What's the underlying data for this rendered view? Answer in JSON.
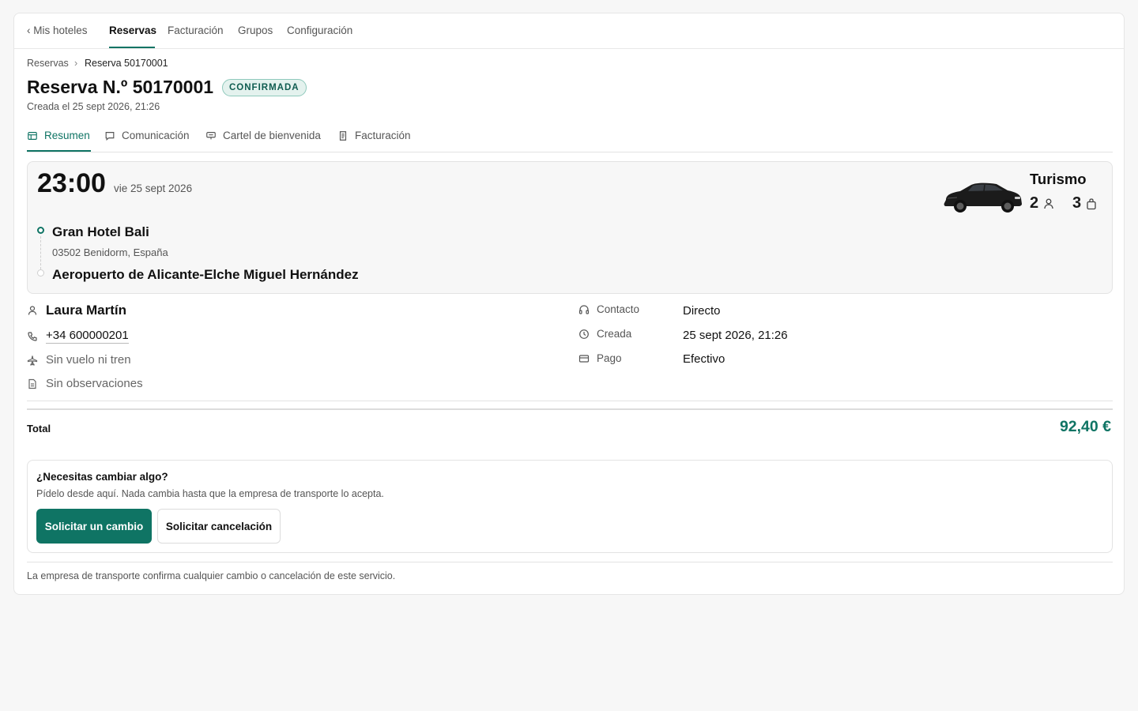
{
  "topnav": {
    "back_label": "‹ Mis hoteles",
    "items": [
      "Reservas",
      "Facturación",
      "Grupos",
      "Configuración"
    ],
    "active": "Reservas"
  },
  "breadcrumb": {
    "parent": "Reservas",
    "separator": "›",
    "current": "Reserva 50170001"
  },
  "booking": {
    "title": "Reserva N.º 50170001",
    "status": "CONFIRMADA",
    "created_line": "Creada el 25 sept 2026, 21:26"
  },
  "subtabs": [
    {
      "label": "Resumen",
      "icon": "summary-icon",
      "active": true
    },
    {
      "label": "Comunicación",
      "icon": "chat-icon",
      "active": false
    },
    {
      "label": "Cartel de bienvenida",
      "icon": "sign-icon",
      "active": false
    },
    {
      "label": "Facturación",
      "icon": "invoice-icon",
      "active": false
    }
  ],
  "trip": {
    "time": "23:00",
    "date": "vie 25 sept 2026",
    "origin_name": "Gran Hotel Bali",
    "origin_address": "03502 Benidorm, España",
    "destination_name": "Aeropuerto de Alicante-Elche Miguel Hernández",
    "vehicle_type": "Turismo",
    "passengers": "2",
    "luggage": "3"
  },
  "guest": {
    "name": "Laura Martín",
    "phone": "+34 600000201",
    "flight": "Sin vuelo ni tren",
    "notes": "Sin observaciones"
  },
  "meta": [
    {
      "label": "Contacto",
      "value": "Directo",
      "icon": "headset-icon"
    },
    {
      "label": "Creada",
      "value": "25 sept 2026, 21:26",
      "icon": "clock-icon"
    },
    {
      "label": "Pago",
      "value": "Efectivo",
      "icon": "card-icon"
    }
  ],
  "total": {
    "label": "Total",
    "value": "92,40 €"
  },
  "change": {
    "title": "¿Necesitas cambiar algo?",
    "description": "Pídelo desde aquí. Nada cambia hasta que la empresa de transporte lo acepta.",
    "primary_button": "Solicitar un cambio",
    "secondary_button": "Solicitar cancelación"
  },
  "footer_note": "La empresa de transporte confirma cualquier cambio o cancelación de este servicio.",
  "colors": {
    "accent": "#0f7464",
    "badge_bg": "#e4f2ee",
    "badge_border": "#8fc9bc"
  }
}
